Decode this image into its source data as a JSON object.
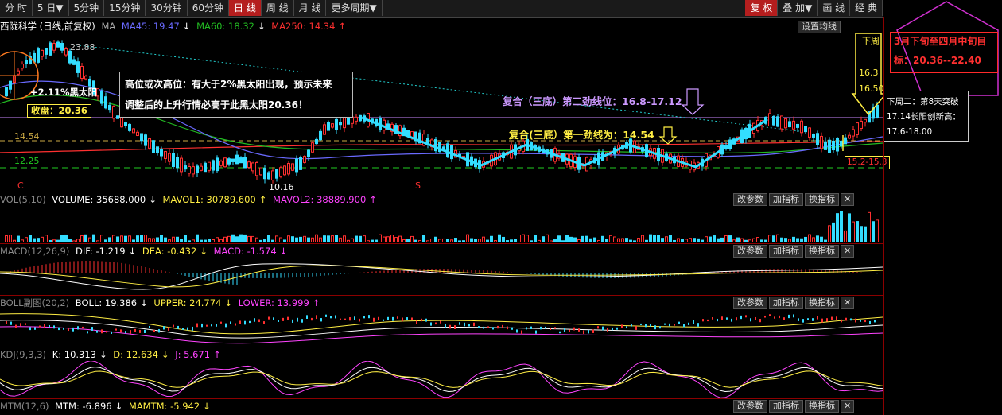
{
  "toolbar": {
    "tabs": [
      "分 时",
      "5 日▼",
      "5分钟",
      "15分钟",
      "30分钟",
      "60分钟",
      "日 线",
      "周 线",
      "月 线",
      "更多周期▼"
    ],
    "active_index": 6,
    "right_tabs": [
      "复 权",
      "叠 加▼",
      "画 线",
      "经 典"
    ]
  },
  "main_panel": {
    "stock_name": "西陇科学 (日线,前复权)",
    "ma_label": "MA",
    "ma45": "MA45: 19.47",
    "ma60": "MA60: 18.32",
    "ma250": "MA250: 14.34",
    "settings_button": "设置均线",
    "colors": {
      "ma45": "#6a6aff",
      "ma60": "#22bb22",
      "ma250": "#ff3030"
    }
  },
  "annotations": {
    "high_label": "23.88",
    "low_label": "10.16",
    "price_14": "14.54",
    "price_12": "12.25",
    "pct_label": "+2.11%黑太阳",
    "close_label": "收盘：20.36",
    "note_line1": "高位或次高位：有大于2%黑太阳出现，预示未来",
    "note_line2": "调整后的上升行情必高于此黑太阳20.36！",
    "second_line": "复合（三底）第二劲线位：16.8-17.12",
    "first_line": "复合(三底）第一劲线为：14.54",
    "target_box_line1": "3月下旬至四月中旬目",
    "target_box_line2": "标：20.36--22.40",
    "arrow_next_week": "下周",
    "arrow_price1": "16.3",
    "arrow_price2": "16.50",
    "breakout_line1": "下周二：第8天突破",
    "breakout_line2": "17.14长阳创新高：",
    "breakout_line3": "17.6-18.00",
    "range_label": "15.2-15.3",
    "marker_c": "C",
    "marker_s": "S"
  },
  "vol_panel": {
    "name": "VOL(5,10)",
    "volume": "VOLUME: 35688.000",
    "mavol1": "MAVOL1: 30789.600",
    "mavol2": "MAVOL2: 38889.900"
  },
  "macd_panel": {
    "name": "MACD(12,26,9)",
    "dif": "DIF: -1.219",
    "dea": "DEA: -0.432",
    "macd": "MACD: -1.574"
  },
  "boll_panel": {
    "name": "BOLL副图(20,2)",
    "boll": "BOLL: 19.386",
    "upper": "UPPER: 24.774",
    "lower": "LOWER: 13.999"
  },
  "kdj_panel": {
    "name": "KDJ(9,3,3)",
    "k": "K: 10.313",
    "d": "D: 12.634",
    "j": "J: 5.671"
  },
  "mtm_panel": {
    "name": "MTM(12,6)",
    "mtm": "MTM: -6.896",
    "mamtm": "MAMTM: -5.942"
  },
  "panel_buttons": {
    "change": "改参数",
    "add": "加指标",
    "switch": "换指标",
    "close": "✕"
  },
  "chart_data": {
    "type": "candlestick",
    "title": "西陇科学 (日线,前复权)",
    "ylim": [
      10,
      24
    ],
    "key_levels": [
      23.88,
      20.36,
      17.12,
      16.8,
      14.54,
      12.25,
      10.16
    ],
    "ma": {
      "MA45": 19.47,
      "MA60": 18.32,
      "MA250": 14.34
    },
    "pattern": "W-shaped triple bottom between 14.54 and 16.8",
    "volume": {
      "VOLUME": 35688.0,
      "MAVOL1": 30789.6,
      "MAVOL2": 38889.9
    },
    "macd": {
      "DIF": -1.219,
      "DEA": -0.432,
      "MACD": -1.574
    },
    "boll": {
      "BOLL": 19.386,
      "UPPER": 24.774,
      "LOWER": 13.999
    },
    "kdj": {
      "K": 10.313,
      "D": 12.634,
      "J": 5.671
    },
    "mtm": {
      "MTM": -6.896,
      "MAMTM": -5.942
    }
  }
}
